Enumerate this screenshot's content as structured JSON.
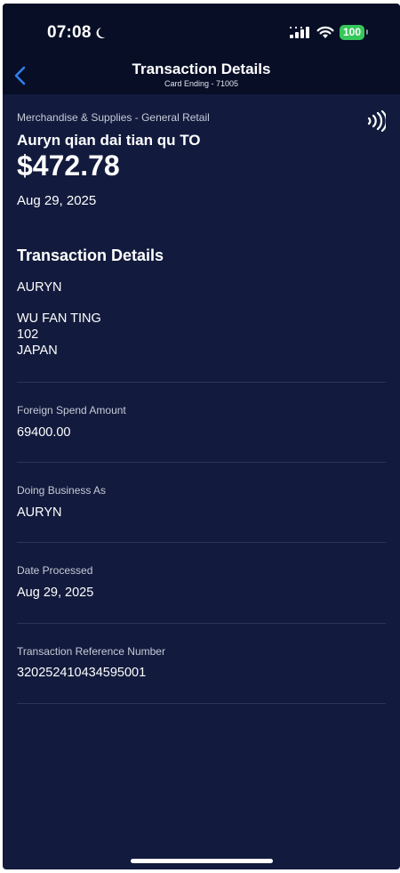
{
  "status_bar": {
    "time": "07:08",
    "battery": "100",
    "icons": [
      "moon-icon",
      "cellular-signal-icon",
      "wifi-icon",
      "battery-icon"
    ]
  },
  "nav": {
    "title": "Transaction Details",
    "subtitle": "Card Ending - 71005",
    "back_icon": "chevron-left-icon"
  },
  "summary": {
    "category": "Merchandise & Supplies - General Retail",
    "merchant": "Auryn qian dai tian qu TO",
    "amount": "$472.78",
    "date": "Aug 29, 2025",
    "payment_icon": "contactless-icon"
  },
  "details": {
    "section_title": "Transaction Details",
    "merchant_name": "AURYN",
    "address_lines": [
      "WU FAN TING",
      "102",
      "JAPAN"
    ]
  },
  "fields": [
    {
      "label": "Foreign Spend Amount",
      "value": "69400.00"
    },
    {
      "label": "Doing Business As",
      "value": "AURYN"
    },
    {
      "label": "Date Processed",
      "value": "Aug 29, 2025"
    },
    {
      "label": "Transaction Reference Number",
      "value": "320252410434595001"
    }
  ],
  "colors": {
    "background": "#121b3d",
    "header_background": "#070e26",
    "accent": "#2f80ed",
    "battery": "#35c759"
  }
}
